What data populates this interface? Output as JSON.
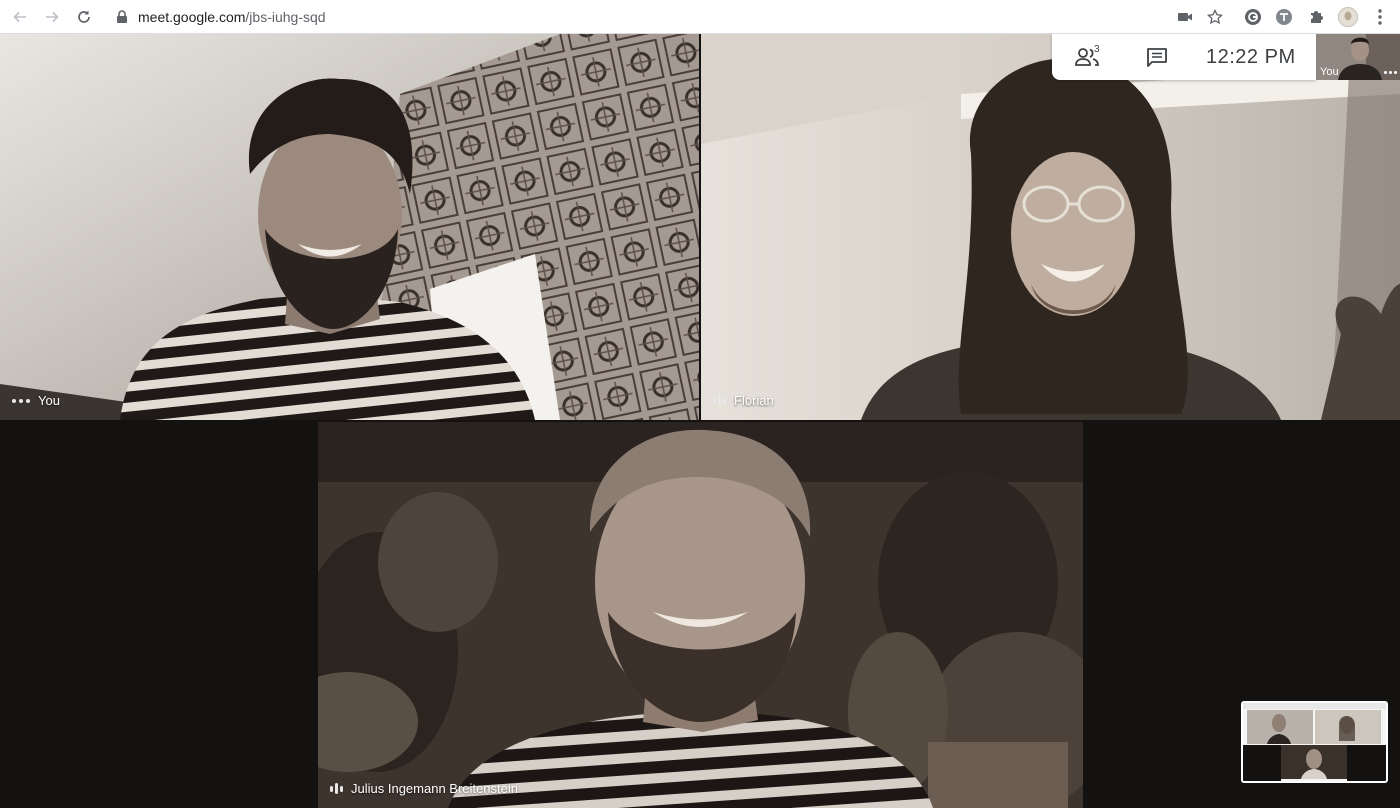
{
  "browser": {
    "url_host": "meet.google.com",
    "url_path": "/jbs-iuhg-sqd",
    "icons": [
      "back-arrow-icon",
      "forward-arrow-icon",
      "reload-icon",
      "lock-icon",
      "camera-icon",
      "star-icon",
      "extension-g-icon",
      "extension-translate-icon",
      "puzzle-icon",
      "profile-avatar-icon",
      "kebab-menu-icon"
    ]
  },
  "meet": {
    "participants_count": "3",
    "clock": "12:22  PM",
    "self_thumb_label": "You",
    "tiles": [
      {
        "name": "You",
        "indicator": "more-dots"
      },
      {
        "name": "Florian",
        "indicator": "audio-bars"
      },
      {
        "name": "Julius Ingemann Breitenstein",
        "indicator": "audio-bars"
      }
    ]
  },
  "colors": {
    "stage_bg": "#141210",
    "panel_bg": "#ffffff",
    "icon_gray": "#5f6368",
    "text_dark": "#3c4043"
  }
}
